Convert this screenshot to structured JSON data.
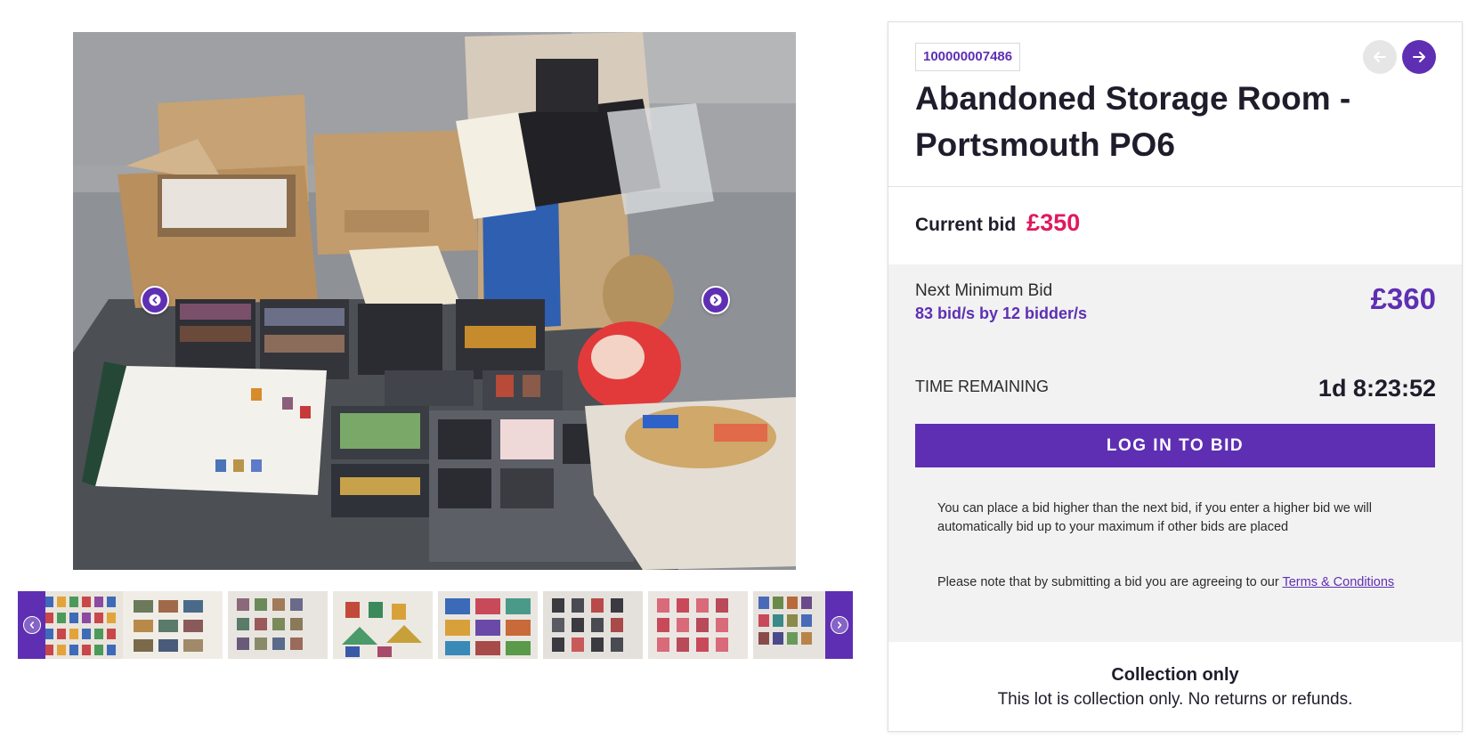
{
  "lot": {
    "number": "100000007486",
    "title": "Abandoned Storage Room - Portsmouth PO6"
  },
  "bidding": {
    "current_bid_label": "Current bid",
    "current_bid_amount": "£350",
    "next_min_label": "Next Minimum Bid",
    "bid_count": "83 bid/s by 12 bidder/s",
    "next_min_amount": "£360",
    "time_label": "TIME REMAINING",
    "time_value": "1d 8:23:52",
    "login_button": "LOG IN TO BID",
    "info": "You can place a bid higher than the next bid, if you enter a higher bid we will automatically bid up to your maximum if other bids are placed",
    "terms_prefix": "Please note that by submitting a bid you are agreeing to our ",
    "terms_link": "Terms & Conditions"
  },
  "collection": {
    "title": "Collection only",
    "text": "This lot is collection only. No returns or refunds."
  },
  "gallery": {
    "thumbnail_count": 8,
    "icons": {
      "prev": "chevron-left-icon",
      "next": "chevron-right-icon",
      "lot_prev": "arrow-left-icon",
      "lot_next": "arrow-right-icon"
    }
  },
  "colors": {
    "brand_purple": "#5e2fb3",
    "bid_pink": "#e0195f",
    "panel_gray": "#f2f2f2",
    "text_dark": "#1f1d2b"
  }
}
